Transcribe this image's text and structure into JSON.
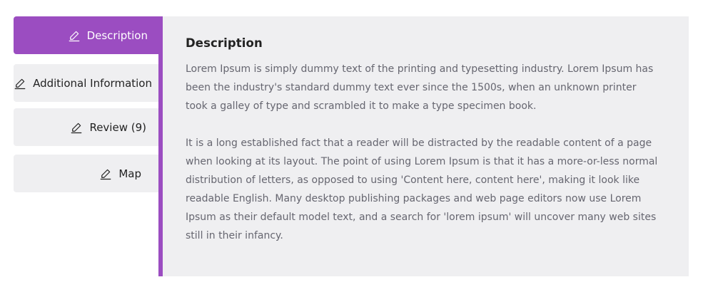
{
  "tabs": [
    {
      "label": "Description",
      "icon": "pencil-icon",
      "active": true
    },
    {
      "label": "Additional Information",
      "icon": "pencil-icon",
      "active": false
    },
    {
      "label": "Review (9)",
      "icon": "pencil-icon",
      "active": false
    },
    {
      "label": "Map",
      "icon": "pencil-icon",
      "active": false
    }
  ],
  "panel": {
    "title": "Description",
    "paragraphs": [
      "Lorem Ipsum is simply dummy text of the printing and typesetting industry. Lorem Ipsum has been the industry's standard dummy text ever since the 1500s, when an unknown printer took a galley of type and scrambled it to make a type specimen book.",
      "It is a long established fact that a reader will be distracted by the readable content of a page when looking at its layout. The point of using Lorem Ipsum is that it has a more-or-less normal distribution of letters, as opposed to using 'Content here, content here', making it look like readable English. Many desktop publishing packages and web page editors now use Lorem Ipsum as their default model text, and a search for 'lorem ipsum' will uncover many web sites still in their infancy."
    ]
  },
  "colors": {
    "accent": "#9b4dc1",
    "panel_bg": "#efeff1",
    "text": "#666670",
    "heading": "#222222"
  }
}
